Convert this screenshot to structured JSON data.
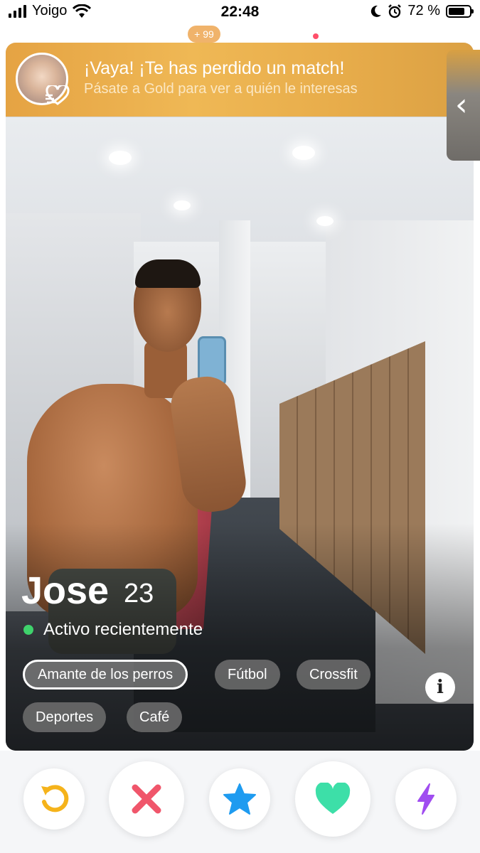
{
  "status_bar": {
    "carrier": "Yoigo",
    "time": "22:48",
    "battery": "72 %"
  },
  "top_nav": {
    "badge": "+ 99"
  },
  "banner": {
    "title": "¡Vaya! ¡Te has perdido un match!",
    "subtitle": "Pásate a Gold para ver a quién le interesas"
  },
  "profile": {
    "name": "Jose",
    "age": "23",
    "status": "Activo recientemente",
    "tags": [
      "Amante de los perros",
      "Fútbol",
      "Crossfit",
      "Deportes",
      "Café"
    ],
    "highlighted_tag": "Amante de los perros"
  },
  "actions": {
    "icons": [
      "rewind-icon",
      "nope-icon",
      "super-like-icon",
      "like-icon",
      "boost-icon"
    ],
    "colors": {
      "rewind": "#f5b31b",
      "nope": "#f0566b",
      "super_like": "#1e9bf0",
      "like": "#3ddfa8",
      "boost": "#a04df0"
    }
  },
  "colors": {
    "gold_banner": "#e8ad4b",
    "online_dot": "#3fd26c"
  }
}
